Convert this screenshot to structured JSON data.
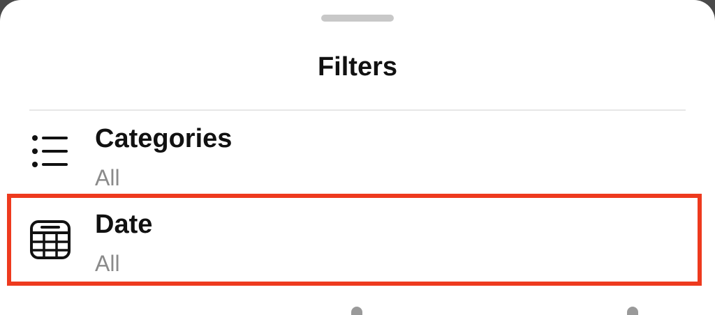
{
  "sheet": {
    "title": "Filters"
  },
  "filters": [
    {
      "label": "Categories",
      "value": "All",
      "icon": "list-icon"
    },
    {
      "label": "Date",
      "value": "All",
      "icon": "calendar-icon"
    }
  ],
  "colors": {
    "highlight": "#ee3a1e",
    "title_text": "#111111",
    "subtitle_text": "#8a8a8a",
    "divider": "#e6e6e6",
    "handle": "#c8c8c8"
  }
}
